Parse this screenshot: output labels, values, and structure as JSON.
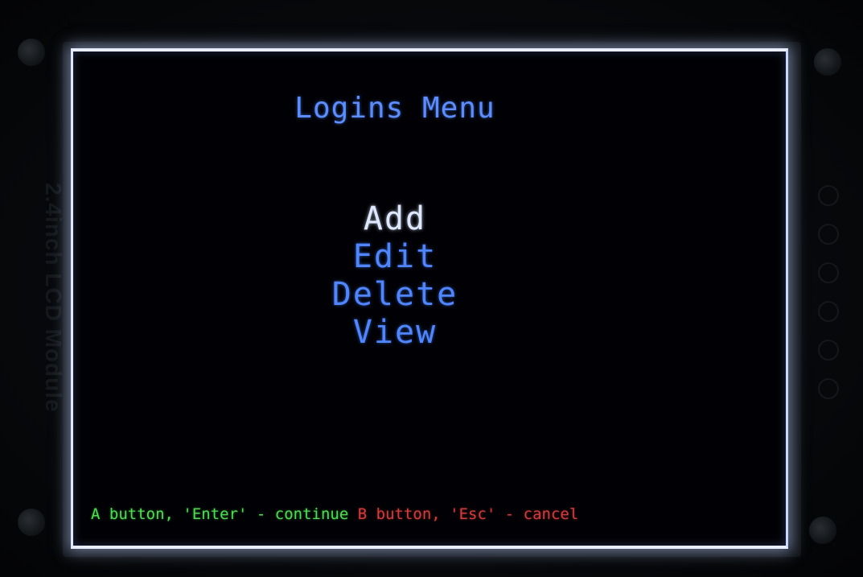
{
  "pcb": {
    "label": "2.4inch LCD Module"
  },
  "screen": {
    "title": "Logins Menu",
    "menu_items": [
      {
        "label": "Add",
        "selected": true
      },
      {
        "label": "Edit",
        "selected": false
      },
      {
        "label": "Delete",
        "selected": false
      },
      {
        "label": "View",
        "selected": false
      }
    ],
    "hints": {
      "continue": "A button, 'Enter' - continue",
      "cancel": "B button, 'Esc' - cancel"
    }
  },
  "colors": {
    "title": "#5c8dff",
    "menu_item": "#4f86ff",
    "menu_item_selected": "#dde8ff",
    "hint_continue": "#4fdc52",
    "hint_cancel": "#d23c3c",
    "screen_background": "#000005"
  }
}
